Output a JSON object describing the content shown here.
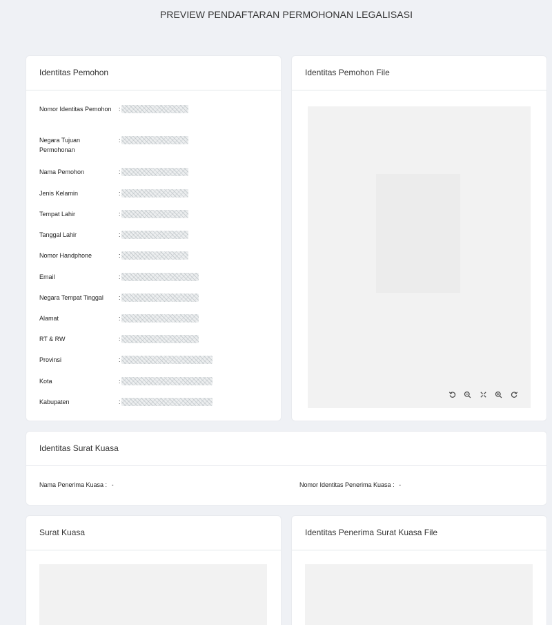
{
  "page_title": "PREVIEW PENDAFTARAN PERMOHONAN LEGALISASI",
  "identitas_pemohon": {
    "title": "Identitas Pemohon",
    "fields": [
      {
        "label": "Nomor Identitas Pemohon",
        "colon": ":"
      },
      {
        "label": "Negara Tujuan Permohonan",
        "colon": ":"
      },
      {
        "label": "Nama Pemohon",
        "colon": ":"
      },
      {
        "label": "Jenis Kelamin",
        "colon": ":"
      },
      {
        "label": "Tempat Lahir",
        "colon": ":"
      },
      {
        "label": "Tanggal Lahir",
        "colon": ":"
      },
      {
        "label": "Nomor Handphone",
        "colon": ":"
      },
      {
        "label": "Email",
        "colon": ":"
      },
      {
        "label": "Negara Tempat Tinggal",
        "colon": ":"
      },
      {
        "label": "Alamat",
        "colon": ":"
      },
      {
        "label": "RT & RW",
        "colon": ":"
      },
      {
        "label": "Provinsi",
        "colon": ":"
      },
      {
        "label": "Kota",
        "colon": ":"
      },
      {
        "label": "Kabupaten",
        "colon": ":"
      }
    ]
  },
  "identitas_pemohon_file": {
    "title": "Identitas Pemohon File",
    "toolbar_icons": [
      "rotate-left-icon",
      "zoom-out-icon",
      "fit-screen-icon",
      "zoom-in-icon",
      "rotate-right-icon"
    ]
  },
  "identitas_surat_kuasa": {
    "title": "Identitas Surat Kuasa",
    "nama_penerima_label": "Nama Penerima Kuasa :",
    "nama_penerima_value": "-",
    "nomor_identitas_label": "Nomor Identitas Penerima Kuasa :",
    "nomor_identitas_value": "-"
  },
  "surat_kuasa": {
    "title": "Surat Kuasa"
  },
  "identitas_penerima_file": {
    "title": "Identitas Penerima Surat Kuasa File"
  }
}
